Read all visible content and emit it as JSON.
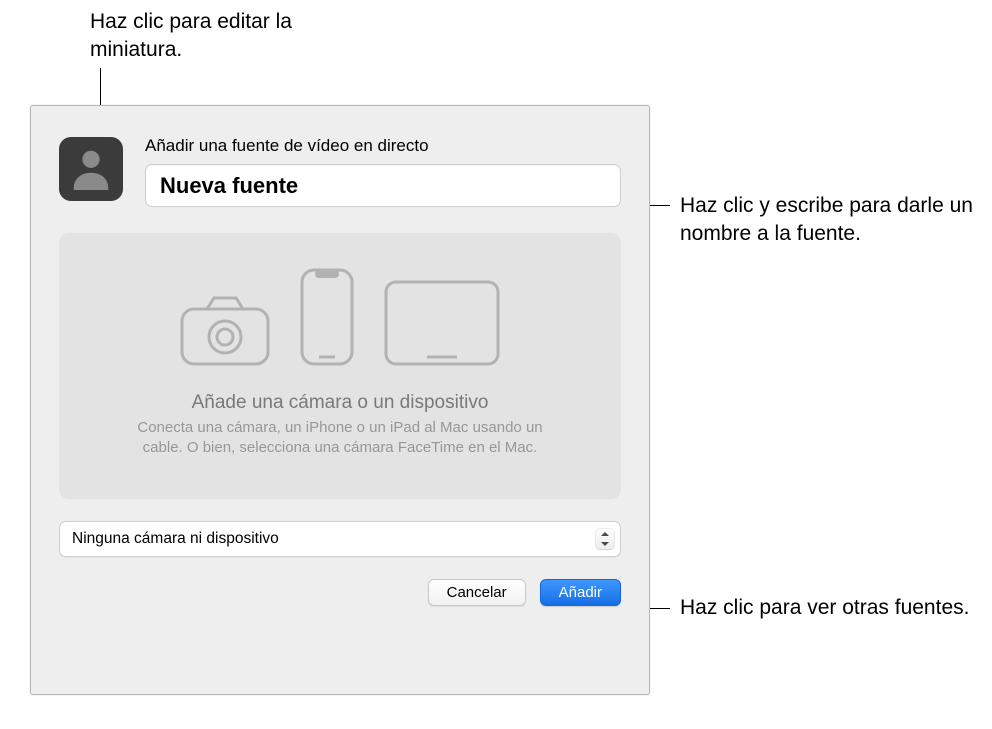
{
  "callouts": {
    "thumbnail": "Haz clic para editar la miniatura.",
    "name": "Haz clic y escribe para darle un nombre a la fuente.",
    "sources": "Haz clic para ver otras fuentes."
  },
  "dialog": {
    "title": "Añadir una fuente de vídeo en directo",
    "source_name": "Nueva fuente",
    "placeholder_area": {
      "heading": "Añade una cámara o un dispositivo",
      "subtext": "Conecta una cámara, un iPhone o un iPad al Mac usando un cable. O bien, selecciona una cámara FaceTime en el Mac."
    },
    "device_select": {
      "value": "Ninguna cámara ni dispositivo"
    },
    "buttons": {
      "cancel": "Cancelar",
      "add": "Añadir"
    }
  }
}
